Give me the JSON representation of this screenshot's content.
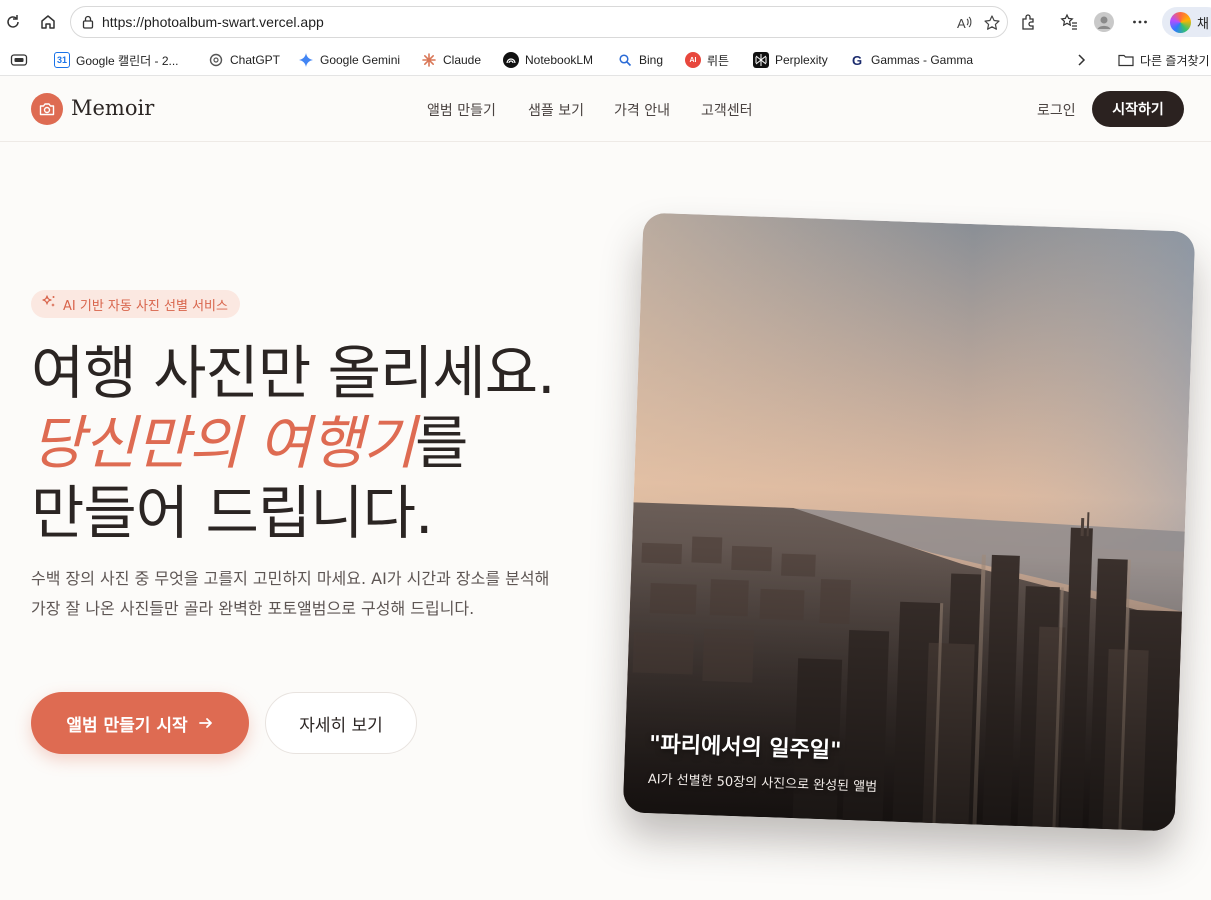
{
  "browser": {
    "url": "https://photoalbum-swart.vercel.app",
    "copilot_label": "채",
    "bookmarks": [
      {
        "label": "Google 캘린더 - 2...",
        "icon": "calendar-icon",
        "color": "#1a73e8"
      },
      {
        "label": "ChatGPT",
        "icon": "chatgpt-icon",
        "color": "#555555"
      },
      {
        "label": "Google Gemini",
        "icon": "gemini-icon",
        "color": "#4285f4"
      },
      {
        "label": "Claude",
        "icon": "claude-icon",
        "color": "#d97757"
      },
      {
        "label": "NotebookLM",
        "icon": "notebooklm-icon",
        "color": "#111111"
      },
      {
        "label": "Bing",
        "icon": "bing-icon",
        "color": "#2b6bd6"
      },
      {
        "label": "뤼튼",
        "icon": "wrtn-icon",
        "color": "#e8473d"
      },
      {
        "label": "Perplexity",
        "icon": "perplexity-icon",
        "color": "#111111"
      },
      {
        "label": "Gammas - Gamma",
        "icon": "gamma-icon",
        "color": "#1a2a6c"
      }
    ],
    "other_bookmarks": "다른 즐겨찾기"
  },
  "site": {
    "brand": "Memoir",
    "accent_color": "#de6b52",
    "nav": [
      "앨범 만들기",
      "샘플 보기",
      "가격 안내",
      "고객센터"
    ],
    "login": "로그인",
    "start": "시작하기"
  },
  "hero": {
    "badge": "AI 기반 자동 사진 선별 서비스",
    "headline_line1": "여행 사진만 올리세요.",
    "headline_accent": "당신만의 여행기",
    "headline_line2_rest": "를",
    "headline_line3": "만들어 드립니다.",
    "description": "수백 장의 사진 중 무엇을 고를지 고민하지 마세요. AI가 시간과 장소를 분석해 가장 잘 나온 사진들만 골라 완벽한 포토앨범으로 구성해 드립니다.",
    "cta_primary": "앨범 만들기 시작",
    "cta_secondary": "자세히 보기"
  },
  "photo": {
    "title": "\"파리에서의 일주일\"",
    "subtitle": "AI가 선별한 50장의 사진으로 완성된 앨범"
  }
}
